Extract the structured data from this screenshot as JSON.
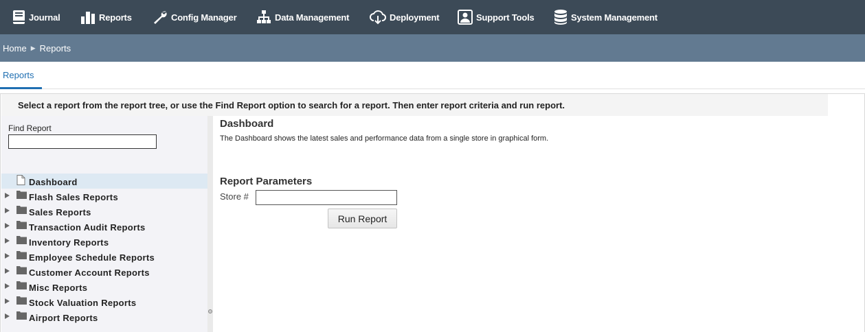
{
  "nav": {
    "items": [
      {
        "label": "Journal",
        "icon": "journal-book-icon"
      },
      {
        "label": "Reports",
        "icon": "bar-chart-icon"
      },
      {
        "label": "Config Manager",
        "icon": "wrench-icon"
      },
      {
        "label": "Data Management",
        "icon": "hierarchy-icon"
      },
      {
        "label": "Deployment",
        "icon": "cloud-download-icon"
      },
      {
        "label": "Support Tools",
        "icon": "support-person-icon"
      },
      {
        "label": "System Management",
        "icon": "database-icon"
      }
    ]
  },
  "breadcrumb": {
    "items": [
      "Home",
      "Reports"
    ],
    "separator": "▶"
  },
  "tabs": [
    {
      "label": "Reports",
      "active": true
    }
  ],
  "instruction": "Select a report from the report tree, or use the Find Report option to search for a report. Then enter report criteria and run report.",
  "find_report": {
    "label": "Find Report",
    "value": ""
  },
  "tree": {
    "items": [
      {
        "label": "Dashboard",
        "type": "file",
        "selected": true
      },
      {
        "label": "Flash Sales Reports",
        "type": "folder"
      },
      {
        "label": "Sales Reports",
        "type": "folder"
      },
      {
        "label": "Transaction Audit Reports",
        "type": "folder"
      },
      {
        "label": "Inventory Reports",
        "type": "folder"
      },
      {
        "label": "Employee Schedule Reports",
        "type": "folder"
      },
      {
        "label": "Customer Account Reports",
        "type": "folder"
      },
      {
        "label": "Misc Reports",
        "type": "folder"
      },
      {
        "label": "Stock Valuation Reports",
        "type": "folder"
      },
      {
        "label": "Airport Reports",
        "type": "folder"
      }
    ]
  },
  "report": {
    "title": "Dashboard",
    "description": "The Dashboard shows the latest sales and performance data from a single store in graphical form.",
    "params_title": "Report Parameters",
    "store_label": "Store #",
    "store_value": "",
    "run_label": "Run Report"
  },
  "colors": {
    "nav_bg": "#3c4a57",
    "breadcrumb_bg": "#627a91",
    "tab_accent": "#1f6fb2",
    "left_panel_bg": "#f3f3f7",
    "tree_selected_bg": "#dde9f3"
  }
}
